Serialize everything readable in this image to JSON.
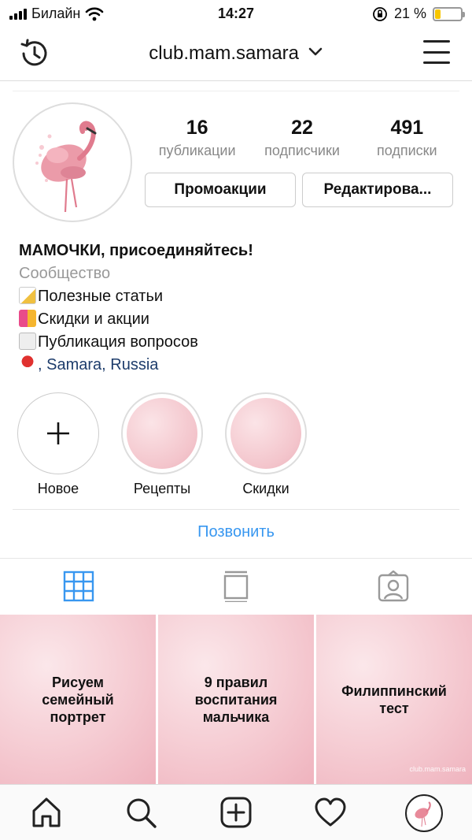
{
  "status_bar": {
    "carrier": "Билайн",
    "time": "14:27",
    "battery": "21 %",
    "battery_level": 0.21
  },
  "header": {
    "username": "club.mam.samara",
    "chevron": "chevron-down-icon",
    "left_icon": "history-icon",
    "right_icon": "menu-icon"
  },
  "profile": {
    "stats": [
      {
        "value": "16",
        "label": "публикации"
      },
      {
        "value": "22",
        "label": "подписчики"
      },
      {
        "value": "491",
        "label": "подписки"
      }
    ],
    "buttons": {
      "promo": "Промоакции",
      "edit": "Редактирова..."
    },
    "bio": {
      "name": "МАМОЧКИ, присоединяйтесь!",
      "category": "Сообщество",
      "lines": [
        "Полезные статьи",
        "Скидки и акции",
        "Публикация вопросов"
      ],
      "location": ", Samara, Russia"
    }
  },
  "highlights": [
    {
      "label": "Новое",
      "icon": "plus-icon"
    },
    {
      "label": "Рецепты"
    },
    {
      "label": "Скидки"
    }
  ],
  "call_button": "Позвонить",
  "tabs": [
    {
      "icon": "grid-icon",
      "active": true
    },
    {
      "icon": "igtv-icon",
      "active": false
    },
    {
      "icon": "tagged-icon",
      "active": false
    }
  ],
  "posts": [
    {
      "text": "Рисуем семейный портрет"
    },
    {
      "text": "9 правил воспитания мальчика"
    },
    {
      "text": "Филиппинский тест",
      "watermark": "club.mam.samara"
    }
  ],
  "bottom_nav": [
    "home-icon",
    "search-icon",
    "new-post-icon",
    "activity-icon",
    "profile-avatar"
  ],
  "colors": {
    "accent": "#3897f0",
    "location": "#1d3c6b",
    "battery": "#f7c600",
    "pink": "#f5cbd2"
  }
}
